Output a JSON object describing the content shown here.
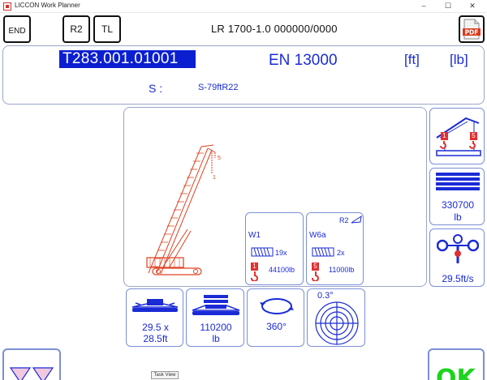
{
  "window": {
    "title": "LICCON Work Planner",
    "minimize": "–",
    "maximize": "☐",
    "close": "✕"
  },
  "toolbar": {
    "end_label": "END",
    "r2_label": "R2",
    "tl_label": "TL",
    "model_text": "LR 1700-1.0  000000/0000",
    "pdf_label": "PDF"
  },
  "info": {
    "code": "T283.001.01001",
    "norm": "EN 13000",
    "unit_length": "[ft]",
    "unit_weight": "[lb]",
    "s_label": "S :",
    "s_value": "S-79ftR22"
  },
  "crane_view": {
    "hook_top_label": "5",
    "hook_bottom_label": "1"
  },
  "winch_w1": {
    "name": "W1",
    "reeving": "19x",
    "hook_number": "1",
    "load": "44100lb"
  },
  "winch_w6a": {
    "name": "W6a",
    "tag": "R2",
    "reeving": "2x",
    "hook_number": "5",
    "load": "11000lb"
  },
  "side": {
    "hook_left": "1",
    "hook_right": "5",
    "counterweight": "330700",
    "counterweight_unit": "lb",
    "wind_speed": "29.5ft/s"
  },
  "bottom": {
    "crawler_dims_1": "29.5 x",
    "crawler_dims_2": "28.5ft",
    "ballast_value": "110200",
    "ballast_unit": "lb",
    "slew_angle": "360°",
    "tilt": "0.3°"
  },
  "footer": {
    "ok_label": "OK",
    "task_tooltip": "Task View"
  },
  "colors": {
    "accent_blue": "#1a2bd6",
    "crane_red": "#e0401f",
    "highlight": "#0b1fd1",
    "ok_green": "#1cd41c"
  }
}
